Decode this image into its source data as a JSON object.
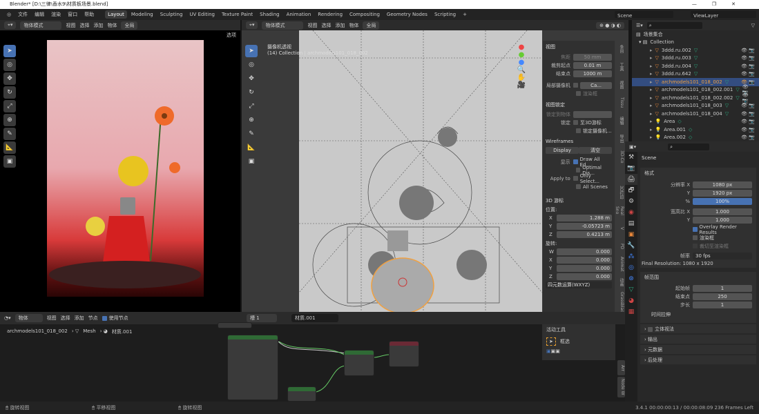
{
  "window": {
    "title": "Blender* [D:\\三律\\香水9\\材质板场景.blend]",
    "controls": [
      "—",
      "❐",
      "✕"
    ]
  },
  "menu": {
    "items": [
      "文件",
      "编辑",
      "渲染",
      "窗口",
      "帮助"
    ],
    "workspaces": [
      "Layout",
      "Modeling",
      "Sculpting",
      "UV Editing",
      "Texture Paint",
      "Shading",
      "Animation",
      "Rendering",
      "Compositing",
      "Geometry Nodes",
      "Scripting",
      "+"
    ],
    "active_workspace": "Layout",
    "scene": "Scene",
    "view_layer": "ViewLayer"
  },
  "viewport_header": {
    "mode": "物体模式",
    "menus": [
      "视图",
      "选择",
      "添加",
      "物体"
    ],
    "transform": "全局",
    "options": "选项"
  },
  "camera_view": {
    "title": "摄像机透视",
    "subtitle": "(14) Collection | archmodels101_018_002"
  },
  "npanel": {
    "view": {
      "header": "视图",
      "focal_label": "焦距",
      "focal": "50 mm",
      "clip_start_label": "裁剪起点",
      "clip_start": "0.01 m",
      "clip_end_label": "结束点",
      "clip_end": "1000 m",
      "local_camera_label": "局部摄像机",
      "local_camera": "Ca...",
      "render_region": "渲染框"
    },
    "view_lock": {
      "header": "视图锁定",
      "lock_object_label": "锁定到物体",
      "lock_label": "锁定",
      "to_cursor": "至3D游标",
      "lock_camera": "锁定摄像机..."
    },
    "wireframes": {
      "header": "Wireframes",
      "display": "Display",
      "clear": "清空",
      "show_label": "显示",
      "draw_all": "Draw All Ed...",
      "optimal": "Optimal Dis...",
      "apply_label": "Apply to",
      "only_selected": "Only Select...",
      "all_scenes": "All Scenes"
    },
    "cursor": {
      "header": "3D 游标",
      "location_label": "位置:",
      "x": "1.288 m",
      "y": "-0.05723 m",
      "z": "0.4213 m",
      "rotation_label": "旋转:",
      "w": "0.000",
      "rx": "0.000",
      "ry": "0.000",
      "rz": "0.000",
      "mode": "四元数运算(WXYZ)"
    },
    "tabs": [
      "条目",
      "工具",
      "视图",
      "Tissu",
      "编辑",
      "导出",
      "3D-Co",
      "",
      "3D打印",
      "Real Sno",
      "V",
      "PD",
      "Animat",
      "动画",
      "Grassblad"
    ]
  },
  "outliner": {
    "root": "场景集合",
    "collection": "Collection",
    "items": [
      {
        "name": "3ddd.ru.002",
        "type": "mesh"
      },
      {
        "name": "3ddd.ru.003",
        "type": "mesh"
      },
      {
        "name": "3ddd.ru.004",
        "type": "mesh"
      },
      {
        "name": "3ddd.ru.642",
        "type": "mesh"
      },
      {
        "name": "archmodels101_018_002",
        "type": "mesh",
        "selected": true
      },
      {
        "name": "archmodels101_018_002.001",
        "type": "mesh"
      },
      {
        "name": "archmodels101_018_002.002",
        "type": "mesh"
      },
      {
        "name": "archmodels101_018_003",
        "type": "mesh"
      },
      {
        "name": "archmodels101_018_004",
        "type": "mesh"
      },
      {
        "name": "Area",
        "type": "light"
      },
      {
        "name": "Area.001",
        "type": "light"
      },
      {
        "name": "Area.002",
        "type": "light"
      }
    ]
  },
  "properties": {
    "scene": "Scene",
    "format": {
      "header": "格式",
      "res_x_label": "分辨率 X",
      "res_x": "1080 px",
      "res_y_label": "Y",
      "res_y": "1920 px",
      "pct_label": "%",
      "pct": "100%",
      "aspect_x_label": "宽高比 X",
      "aspect_x": "1.000",
      "aspect_y_label": "Y",
      "aspect_y": "1.000",
      "overlay": "Overlay Render Results",
      "render_region": "渲染框",
      "crop": "裁切至渲染框",
      "fps_label": "帧率",
      "fps": "30 fps",
      "final": "Final Resolution: 1080 x 1920"
    },
    "frame_range": {
      "header": "帧范围",
      "start_label": "起始帧",
      "start": "1",
      "end_label": "结束点",
      "end": "250",
      "step_label": "步长",
      "step": "1",
      "time_stretch": "时间拉伸"
    },
    "sections": [
      "立体视法",
      "输出",
      "元数据",
      "后处理"
    ]
  },
  "node_editor": {
    "type": "物体",
    "menus": [
      "视图",
      "选择",
      "添加",
      "节点"
    ],
    "use_nodes": "使用节点",
    "slot": "槽 1",
    "material": "材质.001",
    "breadcrumb": [
      "archmodels101_018_002",
      "Mesh",
      "材质.001"
    ],
    "sidebar": {
      "header": "活动工具",
      "tool": "框选"
    },
    "tabs": [
      "Arr",
      "Node W"
    ]
  },
  "status": {
    "hints": [
      "旋转视图",
      "平移视图",
      "旋转视图"
    ],
    "info": "3.4.1  00:00:00:13 / 00:00:08:09  236 Frames Left"
  },
  "colors": {
    "accent": "#4772b3",
    "selected_text": "#f0a040",
    "mesh_icon": "#2aa77d",
    "object_icon": "#e8873a"
  }
}
